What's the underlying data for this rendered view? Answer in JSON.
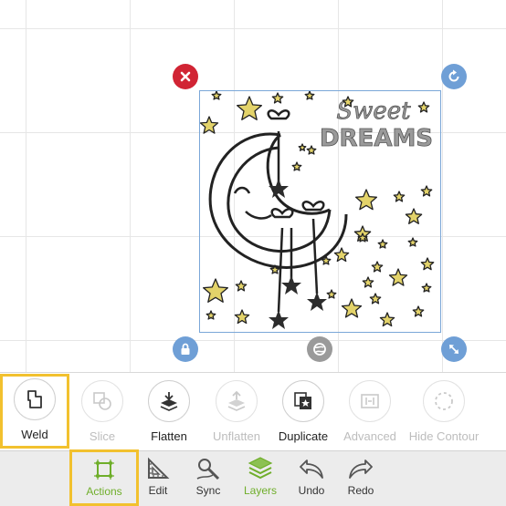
{
  "canvas": {
    "artwork": {
      "text_line1": "Sweet",
      "text_line2": "DREAMS"
    }
  },
  "edit_toolbar": {
    "tools": [
      {
        "label": "Weld",
        "enabled": true,
        "highlighted": true,
        "icon": "weld-icon"
      },
      {
        "label": "Slice",
        "enabled": false,
        "icon": "slice-icon"
      },
      {
        "label": "Flatten",
        "enabled": true,
        "icon": "flatten-icon"
      },
      {
        "label": "Unflatten",
        "enabled": false,
        "icon": "unflatten-icon"
      },
      {
        "label": "Duplicate",
        "enabled": true,
        "icon": "duplicate-icon"
      },
      {
        "label": "Advanced",
        "enabled": false,
        "icon": "advanced-icon"
      },
      {
        "label": "Hide Contour",
        "enabled": false,
        "icon": "hide-contour-icon"
      }
    ]
  },
  "bottom_nav": {
    "items": [
      {
        "label": "Actions",
        "active": true,
        "highlighted": true,
        "icon": "actions-icon"
      },
      {
        "label": "Edit",
        "icon": "edit-icon"
      },
      {
        "label": "Sync",
        "icon": "sync-icon"
      },
      {
        "label": "Layers",
        "active": true,
        "icon": "layers-icon"
      },
      {
        "label": "Undo",
        "icon": "undo-icon"
      },
      {
        "label": "Redo",
        "icon": "redo-icon"
      }
    ]
  },
  "colors": {
    "accent_green": "#6fae2a",
    "highlight_yellow": "#f2c12e",
    "delete_red": "#d12434",
    "handle_blue": "#6f9fd6",
    "star_yellow": "#e3d36a"
  }
}
